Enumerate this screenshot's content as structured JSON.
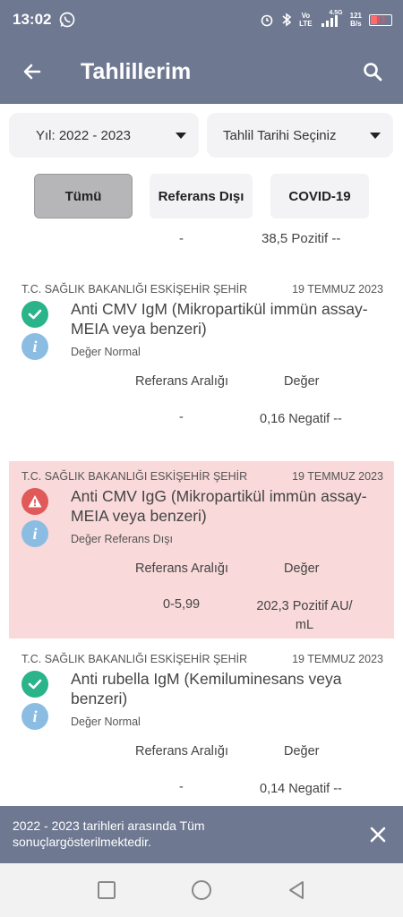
{
  "status_bar": {
    "time": "13:02",
    "net_top": "Vo",
    "net_bottom": "LTE",
    "signal_label": "4.5G",
    "speed_top": "121",
    "speed_bottom": "B/s",
    "battery": "13",
    "icons": [
      "whatsapp-icon",
      "alarm-icon",
      "bluetooth-icon",
      "signal-icon",
      "battery-icon"
    ]
  },
  "app_bar": {
    "title": "Tahlillerim",
    "icons": [
      "back-arrow-icon",
      "search-icon"
    ]
  },
  "filters": {
    "year": "Yıl: 2022 - 2023",
    "date_placeholder": "Tahlil Tarihi Seçiniz",
    "buttons": [
      "Tümü",
      "Referans Dışı",
      "COVID-19"
    ],
    "selected": "Tümü"
  },
  "partial_row": {
    "reference": "-",
    "value": "38,5 Pozitif --"
  },
  "results": [
    {
      "institution": "T.C. SAĞLIK BAKANLIĞI ESKİŞEHİR ŞEHİR",
      "date": "19 TEMMUZ 2023",
      "test_name": "Anti CMV IgM (Mikropartikül immün assay-MEIA veya benzeri)",
      "value_status": "Değer Normal",
      "reference_header": "Referans Aralığı",
      "value_header": "Değer",
      "reference": "-",
      "value": "0,16 Negatif --",
      "status": "normal"
    },
    {
      "institution": "T.C. SAĞLIK BAKANLIĞI ESKİŞEHİR ŞEHİR",
      "date": "19 TEMMUZ 2023",
      "test_name": "Anti CMV IgG (Mikropartikül immün assay-MEIA veya benzeri)",
      "value_status": "Değer Referans Dışı",
      "reference_header": "Referans Aralığı",
      "value_header": "Değer",
      "reference": "0-5,99",
      "value_line1": "202,3 Pozitif AU/",
      "value_line2": "mL",
      "status": "out_of_range"
    },
    {
      "institution": "T.C. SAĞLIK BAKANLIĞI ESKİŞEHİR ŞEHİR",
      "date": "19 TEMMUZ 2023",
      "test_name": "Anti rubella IgM (Kemiluminesans veya benzeri)",
      "value_status": "Değer Normal",
      "reference_header": "Referans Aralığı",
      "value_header": "Değer",
      "reference": "-",
      "value": "0,14 Negatif --",
      "status": "normal"
    }
  ],
  "snackbar": {
    "line1": "2022 - 2023 tarihleri arasında Tüm",
    "line2": "sonuçlargösterilmektedir."
  },
  "colors": {
    "app_bar": "#6e7891",
    "normal_icon": "#2bb38a",
    "alert_icon": "#e05a5a",
    "alert_card": "#f9d9d9",
    "info_icon": "#8bbde3"
  }
}
